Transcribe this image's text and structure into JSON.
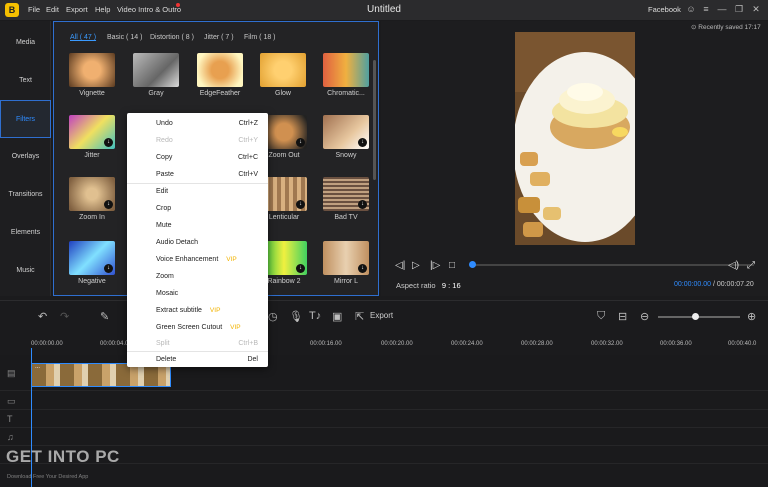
{
  "titlebar": {
    "title": "Untitled",
    "menus": [
      "File",
      "Edit",
      "Help",
      "Video Intro & Outro"
    ],
    "menu_export": "Export",
    "account": "Facebook",
    "logo": "B"
  },
  "sidenav": {
    "items": [
      "Media",
      "Text",
      "Filters",
      "Overlays",
      "Transitions",
      "Elements",
      "Music"
    ],
    "active": "Filters"
  },
  "filters": {
    "tabs": [
      "All ( 47 )",
      "Basic ( 14 )",
      "Distortion ( 8 )",
      "Jitter ( 7 )",
      "Film ( 18 )"
    ],
    "row1": [
      "Vignette",
      "Gray",
      "EdgeFeather",
      "Glow",
      "Chromatic..."
    ],
    "row2": [
      "Jitter",
      "Zoom Out",
      "Snowy"
    ],
    "row3": [
      "Zoom In",
      "Lenticular",
      "Bad TV"
    ],
    "row4": [
      "Negative",
      "Rainbow 2",
      "Mirror L"
    ]
  },
  "preview": {
    "saved": "Recently saved 17:17",
    "aspect_label": "Aspect ratio",
    "aspect_value": "9 : 16",
    "current_time": "00:00:00.00",
    "total_time": "/ 00:00:07.20",
    "progress": 0.0
  },
  "toolbar": {
    "export": "Export",
    "zoom_level": 0.45
  },
  "ruler": [
    "00:00:00.00",
    "00:00:04.00",
    "00:00:16.00",
    "00:00:20.00",
    "00:00:24.00",
    "00:00:28.00",
    "00:00:32.00",
    "00:00:36.00",
    "00:00:40.0"
  ],
  "clip": {
    "label": "..."
  },
  "context_menu": {
    "items": [
      {
        "label": "Undo",
        "shortcut": "Ctrl+Z",
        "disabled": false
      },
      {
        "label": "Redo",
        "shortcut": "Ctrl+Y",
        "disabled": true
      },
      {
        "label": "Copy",
        "shortcut": "Ctrl+C",
        "disabled": false
      },
      {
        "label": "Paste",
        "shortcut": "Ctrl+V",
        "disabled": false
      },
      {
        "label": "Edit",
        "shortcut": "",
        "disabled": false
      },
      {
        "label": "Crop",
        "shortcut": "",
        "disabled": false
      },
      {
        "label": "Mute",
        "shortcut": "",
        "disabled": false
      },
      {
        "label": "Audio Detach",
        "shortcut": "",
        "disabled": false
      },
      {
        "label": "Voice Enhancement",
        "shortcut": "",
        "disabled": false,
        "vip": "VIP"
      },
      {
        "label": "Zoom",
        "shortcut": "",
        "disabled": false
      },
      {
        "label": "Mosaic",
        "shortcut": "",
        "disabled": false
      },
      {
        "label": "Extract subtitle",
        "shortcut": "",
        "disabled": false,
        "vip": "VIP"
      },
      {
        "label": "Green Screen Cutout",
        "shortcut": "",
        "disabled": false,
        "vip": "VIP"
      },
      {
        "label": "Split",
        "shortcut": "Ctrl+B",
        "disabled": true
      },
      {
        "label": "Delete",
        "shortcut": "Del",
        "disabled": false
      }
    ]
  },
  "watermark": {
    "title": "GET INTO PC",
    "subtitle": "Download Free Your Desired App"
  },
  "colors": {
    "accent": "#2f8cff",
    "vip": "#f2b300"
  }
}
